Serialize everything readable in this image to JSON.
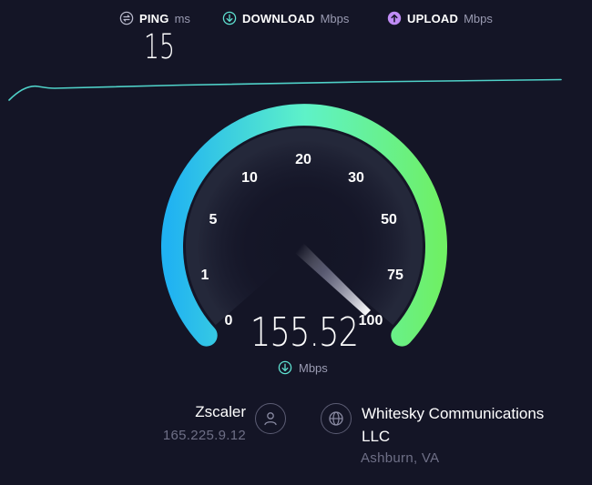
{
  "stats": {
    "ping": {
      "label": "PING",
      "unit": "ms",
      "value": "15",
      "icon": "ping-icon",
      "color": "#b8b9cc"
    },
    "download": {
      "label": "DOWNLOAD",
      "unit": "Mbps",
      "icon": "download-arrow-icon",
      "color": "#5ee0d0"
    },
    "upload": {
      "label": "UPLOAD",
      "unit": "Mbps",
      "icon": "upload-arrow-icon",
      "color": "#c08cf5"
    }
  },
  "gauge": {
    "scale_labels": [
      "0",
      "1",
      "5",
      "10",
      "20",
      "30",
      "50",
      "75",
      "100"
    ],
    "current_speed": "155.52",
    "unit": "Mbps",
    "gradient": [
      "#22b4f0",
      "#5ef0c0",
      "#6cf06a"
    ]
  },
  "provider": {
    "name": "Zscaler",
    "ip": "165.225.9.12",
    "icon": "user-icon"
  },
  "server": {
    "name": "Whitesky Communications LLC",
    "location": "Ashburn, VA",
    "icon": "globe-icon"
  }
}
